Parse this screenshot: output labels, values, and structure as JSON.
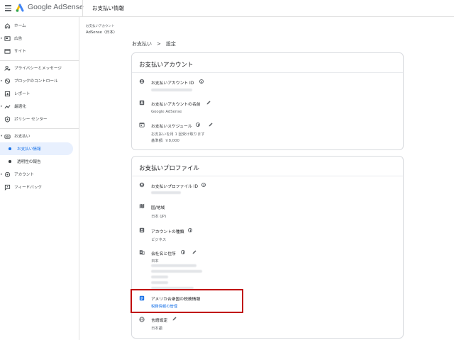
{
  "header": {
    "app_name": "Google AdSense",
    "page_title": "お支払い情報"
  },
  "sidebar": {
    "items": [
      {
        "label": "ホーム",
        "icon": "home-icon"
      },
      {
        "label": "広告",
        "icon": "ads-icon"
      },
      {
        "label": "サイト",
        "icon": "sites-icon"
      },
      {
        "label": "プライバシーとメッセージ",
        "icon": "privacy-icon"
      },
      {
        "label": "ブロックのコントロール",
        "icon": "block-icon"
      },
      {
        "label": "レポート",
        "icon": "report-icon"
      },
      {
        "label": "最適化",
        "icon": "optimize-icon"
      },
      {
        "label": "ポリシー センター",
        "icon": "policy-icon"
      },
      {
        "label": "お支払い",
        "icon": "payments-icon"
      },
      {
        "label": "お支払い情報",
        "icon": ""
      },
      {
        "label": "透明性の報告",
        "icon": ""
      },
      {
        "label": "アカウント",
        "icon": "account-icon"
      },
      {
        "label": "フィードバック",
        "icon": "feedback-icon"
      }
    ]
  },
  "main": {
    "account_label": "お支払いアカウント",
    "account_name": "AdSense（日本）",
    "breadcrumb": "お支払い　>　設定",
    "payment_account": {
      "title": "お支払いアカウント",
      "id_label": "お支払いアカウント ID",
      "name_label": "お支払いアカウントの名前",
      "name_value": "Google AdSense",
      "schedule_label": "お支払いスケジュール",
      "schedule_value": "お支払いを月 1 回受け取ります",
      "threshold_value": "基準額: ￥8,000"
    },
    "payment_profile": {
      "title": "お支払いプロファイル",
      "id_label": "お支払いプロファイル ID",
      "country_label": "国/地域",
      "country_value": "日本 (JP)",
      "type_label": "アカウントの種類",
      "type_value": "ビジネス",
      "address_label": "会社名と住所",
      "address_country": "日本",
      "tax_label": "アメリカ合衆国の税務情報",
      "tax_link": "税務情報の管理",
      "lang_label": "言語設定",
      "lang_value": "日本語"
    }
  },
  "colors": {
    "accent": "#1a73e8",
    "highlight": "#c00000"
  }
}
